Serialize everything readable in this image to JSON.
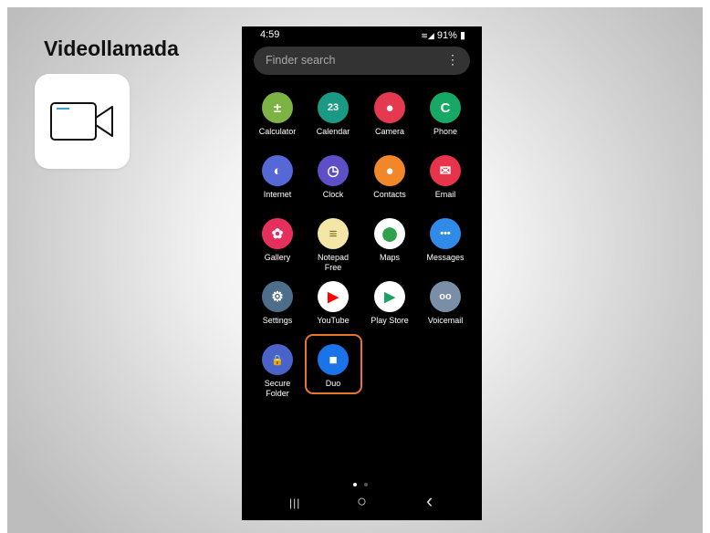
{
  "slide": {
    "title": "Videollamada"
  },
  "phone": {
    "status": {
      "time": "4:59",
      "battery": "91%"
    },
    "search": {
      "placeholder": "Finder search",
      "menu": "⋮"
    },
    "apps": [
      {
        "label": "Calculator",
        "icon": "calculator-icon",
        "color": "#7cb342",
        "glyph": "±",
        "highlighted": false
      },
      {
        "label": "Calendar",
        "icon": "calendar-icon",
        "color": "#1a9a85",
        "glyph": "23",
        "highlighted": false
      },
      {
        "label": "Camera",
        "icon": "camera-icon",
        "color": "#e53950",
        "glyph": "●",
        "highlighted": false
      },
      {
        "label": "Phone",
        "icon": "phone-icon",
        "color": "#17a864",
        "glyph": "C",
        "highlighted": false
      },
      {
        "label": "Internet",
        "icon": "internet-icon",
        "color": "#5668d6",
        "glyph": "◐",
        "highlighted": false
      },
      {
        "label": "Clock",
        "icon": "clock-icon",
        "color": "#5c4fc8",
        "glyph": "◷",
        "highlighted": false
      },
      {
        "label": "Contacts",
        "icon": "contacts-icon",
        "color": "#f2862b",
        "glyph": "●",
        "highlighted": false
      },
      {
        "label": "Email",
        "icon": "email-icon",
        "color": "#e7344a",
        "glyph": "✉",
        "highlighted": false
      },
      {
        "label": "Gallery",
        "icon": "gallery-icon",
        "color": "#e5305e",
        "glyph": "✿",
        "highlighted": false
      },
      {
        "label": "Notepad Free",
        "icon": "notepad-icon",
        "color": "#f3e6a6",
        "glyph": "≡",
        "highlighted": false
      },
      {
        "label": "Maps",
        "icon": "maps-icon",
        "color": "#ffffff",
        "glyph": "⬤",
        "highlighted": false
      },
      {
        "label": "Messages",
        "icon": "messages-icon",
        "color": "#2f8ae8",
        "glyph": "•••",
        "highlighted": false
      },
      {
        "label": "Settings",
        "icon": "settings-icon",
        "color": "#4d6d8a",
        "glyph": "⚙",
        "highlighted": false
      },
      {
        "label": "YouTube",
        "icon": "youtube-icon",
        "color": "#ffffff",
        "glyph": "▶",
        "highlighted": false
      },
      {
        "label": "Play Store",
        "icon": "play-store-icon",
        "color": "#ffffff",
        "glyph": "▶",
        "highlighted": false
      },
      {
        "label": "Voicemail",
        "icon": "voicemail-icon",
        "color": "#7a8ea8",
        "glyph": "oo",
        "highlighted": false
      },
      {
        "label": "Secure Folder",
        "icon": "secure-folder-icon",
        "color": "#4a63c8",
        "glyph": "🔒",
        "highlighted": false
      },
      {
        "label": "Duo",
        "icon": "duo-icon",
        "color": "#1a73e8",
        "glyph": "■",
        "highlighted": true
      }
    ],
    "nav": {
      "recent": "|||",
      "home": "○",
      "back": "‹"
    }
  },
  "colors": {
    "highlight": "#e8762a",
    "background": "#000000"
  }
}
